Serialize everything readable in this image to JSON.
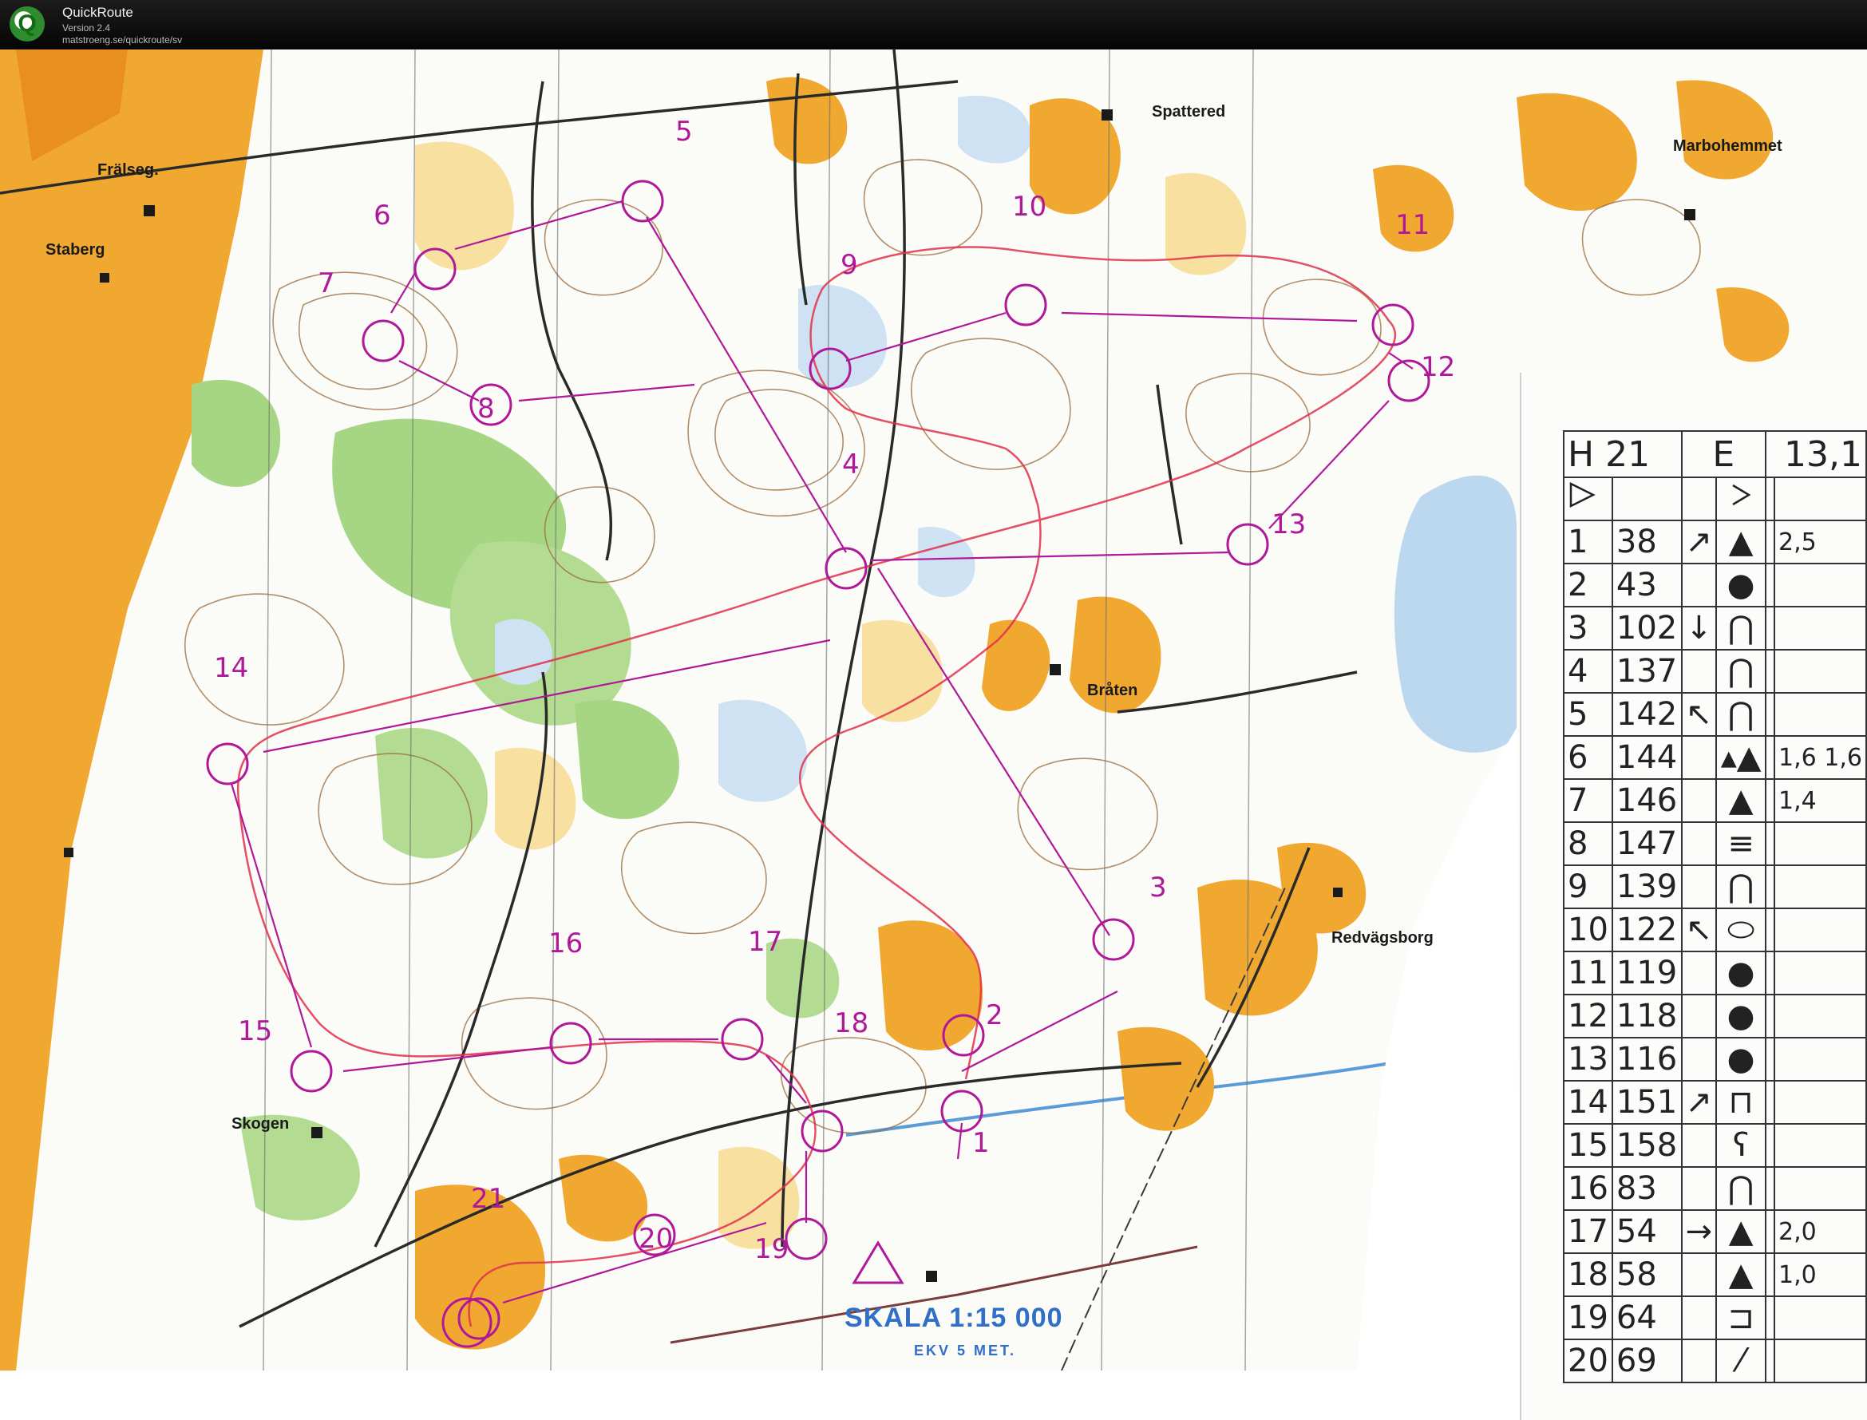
{
  "app": {
    "name": "QuickRoute",
    "version": "Version 2.4",
    "url": "matstroeng.se/quickroute/sv"
  },
  "map": {
    "places": [
      {
        "key": "fralseg",
        "label": "Frälseg."
      },
      {
        "key": "staberg",
        "label": "Staberg"
      },
      {
        "key": "spattered",
        "label": "Spattered"
      },
      {
        "key": "marbohemmet",
        "label": "Marbohemmet"
      },
      {
        "key": "braten",
        "label": "Bråten"
      },
      {
        "key": "redvagsborg",
        "label": "Redvägsborg"
      },
      {
        "key": "skogen",
        "label": "Skogen"
      }
    ],
    "scale": "SKALA 1:15 000",
    "contour": "EKV  5 MET.",
    "control_numbers": [
      "1",
      "2",
      "3",
      "4",
      "5",
      "6",
      "7",
      "8",
      "9",
      "10",
      "11",
      "12",
      "13",
      "14",
      "15",
      "16",
      "17",
      "18",
      "19",
      "20",
      "21"
    ],
    "colors": {
      "open_land": "#f0a830",
      "rough_open": "#f7d98a",
      "forest_green": "#9fd07a",
      "water_blue": "#bcd8ef",
      "course_purple": "#b0189a",
      "route_red": "#e0304a",
      "contour_brown": "#9a6b3a",
      "road_black": "#2a2a2a"
    }
  },
  "card": {
    "header": {
      "class": "H 21",
      "level": "E",
      "distance": "13,1"
    },
    "start_symbol": "start-triangle-icon",
    "controls": [
      {
        "n": "1",
        "code": "38",
        "dir": "↗",
        "feat": "▲",
        "extra": "2,5"
      },
      {
        "n": "2",
        "code": "43",
        "dir": "",
        "feat": "●",
        "extra": ""
      },
      {
        "n": "3",
        "code": "102",
        "dir": "↓",
        "feat": "⋂",
        "extra": ""
      },
      {
        "n": "4",
        "code": "137",
        "dir": "",
        "feat": "⋂",
        "extra": ""
      },
      {
        "n": "5",
        "code": "142",
        "dir": "↖",
        "feat": "⋂",
        "extra": ""
      },
      {
        "n": "6",
        "code": "144",
        "dir": "",
        "feat": "▴▲",
        "extra": "1,6 1,6"
      },
      {
        "n": "7",
        "code": "146",
        "dir": "",
        "feat": "▲",
        "extra": "1,4"
      },
      {
        "n": "8",
        "code": "147",
        "dir": "",
        "feat": "≡",
        "extra": ""
      },
      {
        "n": "9",
        "code": "139",
        "dir": "",
        "feat": "⋂",
        "extra": ""
      },
      {
        "n": "10",
        "code": "122",
        "dir": "↖",
        "feat": "⬭",
        "extra": ""
      },
      {
        "n": "11",
        "code": "119",
        "dir": "",
        "feat": "●",
        "extra": ""
      },
      {
        "n": "12",
        "code": "118",
        "dir": "",
        "feat": "●",
        "extra": ""
      },
      {
        "n": "13",
        "code": "116",
        "dir": "",
        "feat": "●",
        "extra": ""
      },
      {
        "n": "14",
        "code": "151",
        "dir": "↗",
        "feat": "⊓",
        "extra": ""
      },
      {
        "n": "15",
        "code": "158",
        "dir": "",
        "feat": "ʕ",
        "extra": ""
      },
      {
        "n": "16",
        "code": "83",
        "dir": "",
        "feat": "⋂",
        "extra": ""
      },
      {
        "n": "17",
        "code": "54",
        "dir": "→",
        "feat": "▲",
        "extra": "2,0"
      },
      {
        "n": "18",
        "code": "58",
        "dir": "",
        "feat": "▲",
        "extra": "1,0"
      },
      {
        "n": "19",
        "code": "64",
        "dir": "",
        "feat": "⊐",
        "extra": ""
      },
      {
        "n": "20",
        "code": "69",
        "dir": "",
        "feat": "⁄",
        "extra": ""
      }
    ]
  }
}
